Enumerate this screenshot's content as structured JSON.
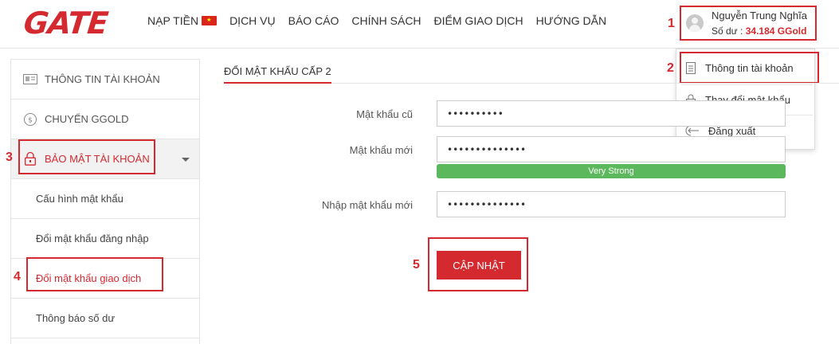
{
  "header": {
    "logo": "GATE",
    "nav": [
      "NẠP TIỀN",
      "DỊCH VỤ",
      "BÁO CÁO",
      "CHÍNH SÁCH",
      "ĐIỂM GIAO DỊCH",
      "HƯỚNG DẪN"
    ],
    "user": {
      "name": "Nguyễn Trung Nghĩa",
      "balance_label": "Số dư :",
      "balance_value": "34.184 GGold"
    }
  },
  "dropdown": {
    "items": [
      "Thông tin tài khoản",
      "Thay đổi mật khẩu",
      "Đăng xuất"
    ]
  },
  "sidebar": {
    "items": [
      "THÔNG TIN TÀI KHOẢN",
      "CHUYỂN GGOLD",
      "BẢO MẬT TÀI KHOẢN"
    ],
    "sub_items": [
      "Cấu hình mật khẩu",
      "Đổi mật khẩu đăng nhập",
      "Đổi mật khẩu giao dịch",
      "Thông báo số dư"
    ]
  },
  "main": {
    "tab": "ĐỔI MẬT KHẨU CẤP 2",
    "fields": [
      {
        "label": "Mật khẩu cũ",
        "value": "••••••••••"
      },
      {
        "label": "Mật khẩu mới",
        "value": "••••••••••••••"
      },
      {
        "label": "Nhập mật khẩu mới",
        "value": "••••••••••••••"
      }
    ],
    "strength": "Very Strong",
    "submit": "CẬP NHẬT"
  },
  "steps": [
    "1",
    "2",
    "3",
    "4",
    "5"
  ],
  "colors": {
    "accent": "#d42a2f",
    "strength": "#5cb85c"
  }
}
